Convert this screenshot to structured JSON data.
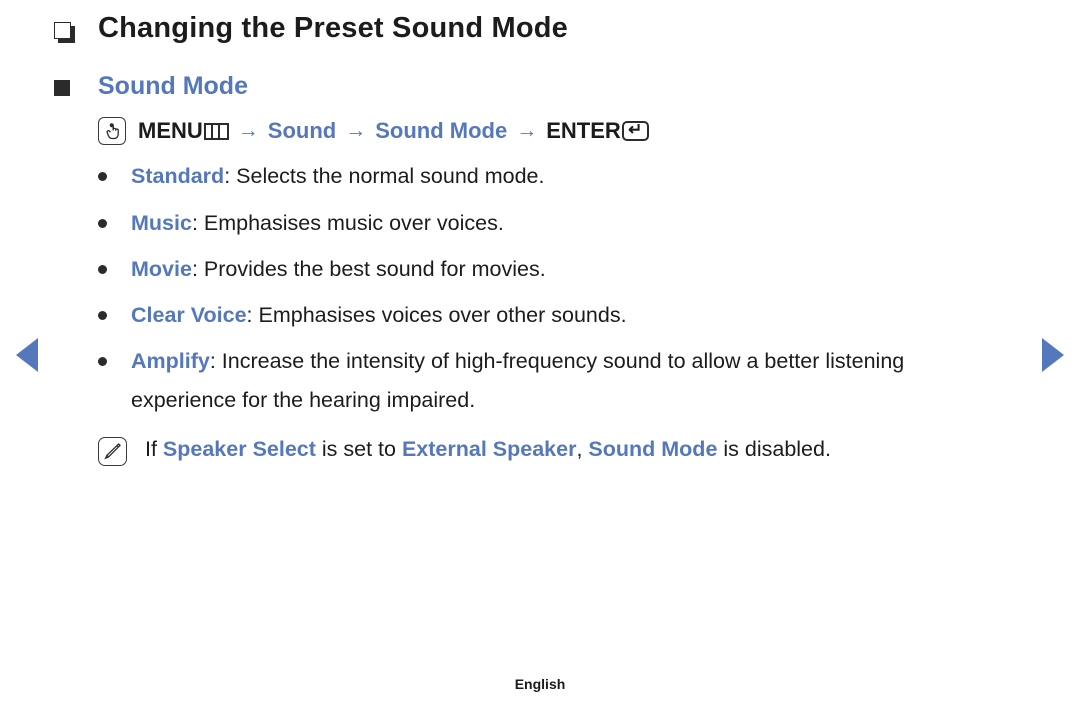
{
  "page": {
    "heading": "Changing the Preset Sound Mode",
    "subheading": "Sound Mode",
    "footer_language": "English"
  },
  "menu_path": {
    "touch_icon": "menu-touch-icon",
    "menu_label": "MENU",
    "menu_glyph": "menu-bars-icon",
    "arrow": "→",
    "step_sound": "Sound",
    "step_sound_mode": "Sound Mode",
    "enter_label": "ENTER",
    "enter_glyph": "↵"
  },
  "options": [
    {
      "term": "Standard",
      "separator": ": ",
      "description": "Selects the normal sound mode."
    },
    {
      "term": "Music",
      "separator": ": ",
      "description": "Emphasises music over voices."
    },
    {
      "term": "Movie",
      "separator": ": ",
      "description": "Provides the best sound for movies."
    },
    {
      "term": "Clear Voice",
      "separator": ": ",
      "description": "Emphasises voices over other sounds."
    },
    {
      "term": "Amplify",
      "separator": ": ",
      "description": "Increase the intensity of high-frequency sound to allow a better listening experience for the hearing impaired."
    }
  ],
  "note": {
    "icon": "note-pencil-icon",
    "prefix": "If ",
    "term1": "Speaker Select",
    "mid1": " is set to ",
    "term2": "External Speaker",
    "mid2": ", ",
    "term3": "Sound Mode",
    "suffix": " is disabled."
  },
  "nav": {
    "prev": "previous-page-arrow",
    "next": "next-page-arrow"
  },
  "colors": {
    "accent_blue": "#5578bd",
    "text_black": "#1c1c1c",
    "background": "#ffffff"
  }
}
